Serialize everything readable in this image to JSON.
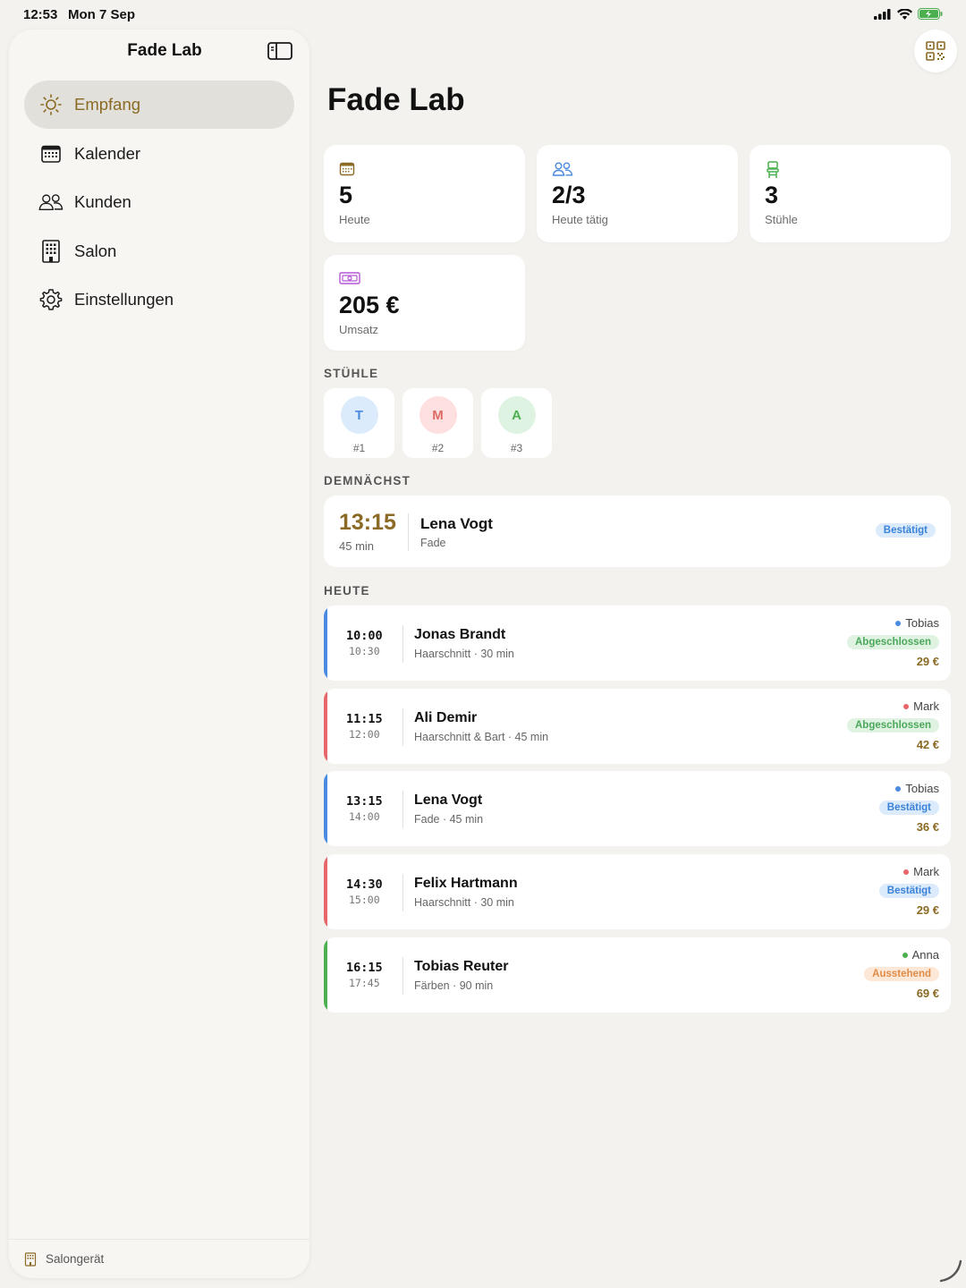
{
  "status_bar": {
    "time": "12:53",
    "date": "Mon 7 Sep"
  },
  "sidebar": {
    "title": "Fade Lab",
    "items": [
      {
        "label": "Empfang",
        "icon": "sun-icon",
        "active": true
      },
      {
        "label": "Kalender",
        "icon": "calendar-icon"
      },
      {
        "label": "Kunden",
        "icon": "people-icon"
      },
      {
        "label": "Salon",
        "icon": "building-icon"
      },
      {
        "label": "Einstellungen",
        "icon": "gear-icon"
      }
    ],
    "footer": "Salongerät"
  },
  "main": {
    "title": "Fade Lab",
    "stats": [
      {
        "value": "5",
        "label": "Heute",
        "icon": "calendar-icon",
        "color": "#8a6a24"
      },
      {
        "value": "2/3",
        "label": "Heute tätig",
        "icon": "people-icon",
        "color": "#4a8ae0"
      },
      {
        "value": "3",
        "label": "Stühle",
        "icon": "chair-icon",
        "color": "#4caf50"
      },
      {
        "value": "205 €",
        "label": "Umsatz",
        "icon": "banknote-icon",
        "color": "#b556d6"
      }
    ],
    "chairs_label": "STÜHLE",
    "chairs": [
      {
        "initial": "T",
        "number": "#1",
        "bg": "#dcebfb",
        "fg": "#4a8ae0"
      },
      {
        "initial": "M",
        "number": "#2",
        "bg": "#fde0df",
        "fg": "#e06a66"
      },
      {
        "initial": "A",
        "number": "#3",
        "bg": "#dff3e2",
        "fg": "#4caf50"
      }
    ],
    "upcoming_label": "DEMNÄCHST",
    "upcoming": {
      "time": "13:15",
      "duration": "45 min",
      "name": "Lena Vogt",
      "service": "Fade",
      "status": "Bestätigt"
    },
    "today_label": "HEUTE",
    "appointments": [
      {
        "start": "10:00",
        "end": "10:30",
        "name": "Jonas Brandt",
        "service": "Haarschnitt · 30 min",
        "barber": "Tobias",
        "barber_color": "#4a8ae0",
        "status": "Abgeschlossen",
        "status_type": "green",
        "price": "29 €"
      },
      {
        "start": "11:15",
        "end": "12:00",
        "name": "Ali Demir",
        "service": "Haarschnitt & Bart · 45 min",
        "barber": "Mark",
        "barber_color": "#e8666a",
        "status": "Abgeschlossen",
        "status_type": "green",
        "price": "42 €"
      },
      {
        "start": "13:15",
        "end": "14:00",
        "name": "Lena Vogt",
        "service": "Fade · 45 min",
        "barber": "Tobias",
        "barber_color": "#4a8ae0",
        "status": "Bestätigt",
        "status_type": "blue",
        "price": "36 €"
      },
      {
        "start": "14:30",
        "end": "15:00",
        "name": "Felix Hartmann",
        "service": "Haarschnitt · 30 min",
        "barber": "Mark",
        "barber_color": "#e8666a",
        "status": "Bestätigt",
        "status_type": "blue",
        "price": "29 €"
      },
      {
        "start": "16:15",
        "end": "17:45",
        "name": "Tobias Reuter",
        "service": "Färben · 90 min",
        "barber": "Anna",
        "barber_color": "#4caf50",
        "status": "Ausstehend",
        "status_type": "orange",
        "price": "69 €"
      }
    ]
  }
}
